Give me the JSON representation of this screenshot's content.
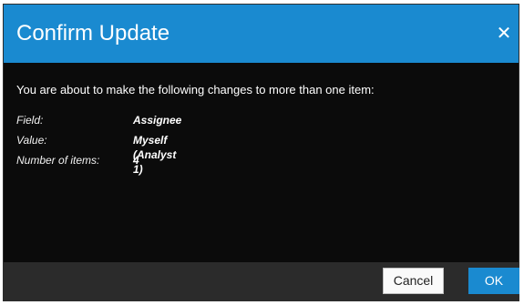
{
  "dialog": {
    "title": "Confirm Update",
    "close_glyph": "✕",
    "message": "You are about to make the following changes to more than one item:",
    "fields": [
      {
        "label": "Field:",
        "value": "Assignee"
      },
      {
        "label": "Value:",
        "value": "Myself (Analyst 1)"
      },
      {
        "label": "Number of items:",
        "value": "4"
      }
    ],
    "buttons": {
      "cancel": "Cancel",
      "ok": "OK"
    }
  },
  "theme": {
    "accent": "#1a8ad0",
    "dialog_background": "#0b0b0b",
    "footer_background": "#2b2b2b",
    "text": "#ffffff"
  }
}
